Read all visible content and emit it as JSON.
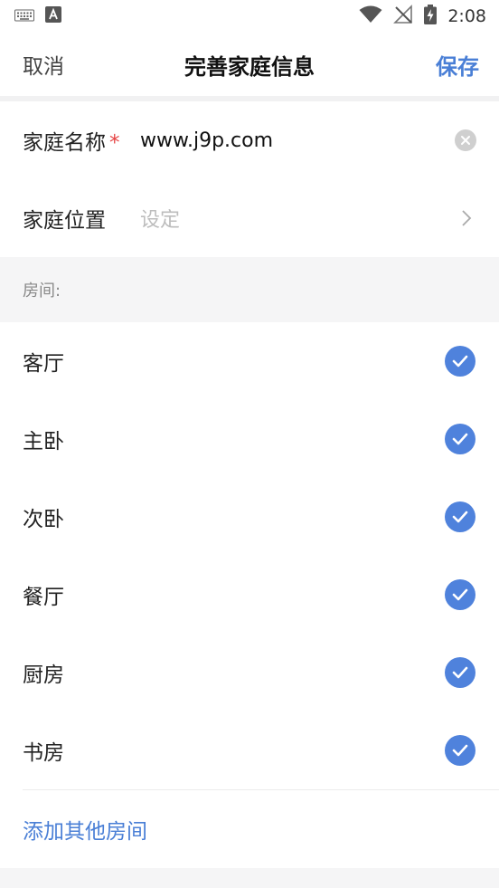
{
  "status_bar": {
    "time": "2:08",
    "icons_left": [
      "keyboard-icon",
      "a-text-icon"
    ],
    "icons_right": [
      "wifi-icon",
      "no-signal-icon",
      "battery-charging-icon"
    ]
  },
  "nav": {
    "cancel_label": "取消",
    "title": "完善家庭信息",
    "save_label": "保存"
  },
  "form": {
    "family_name": {
      "label": "家庭名称",
      "required_mark": "*",
      "value": "www.j9p.com"
    },
    "family_location": {
      "label": "家庭位置",
      "placeholder": "设定"
    }
  },
  "rooms_section": {
    "header": "房间:",
    "rooms": [
      {
        "name": "客厅",
        "checked": true
      },
      {
        "name": "主卧",
        "checked": true
      },
      {
        "name": "次卧",
        "checked": true
      },
      {
        "name": "餐厅",
        "checked": true
      },
      {
        "name": "厨房",
        "checked": true
      },
      {
        "name": "书房",
        "checked": true
      }
    ],
    "add_label": "添加其他房间"
  },
  "colors": {
    "accent": "#4a7fd6",
    "check_fill": "#4f82dc",
    "required": "#e64545"
  }
}
